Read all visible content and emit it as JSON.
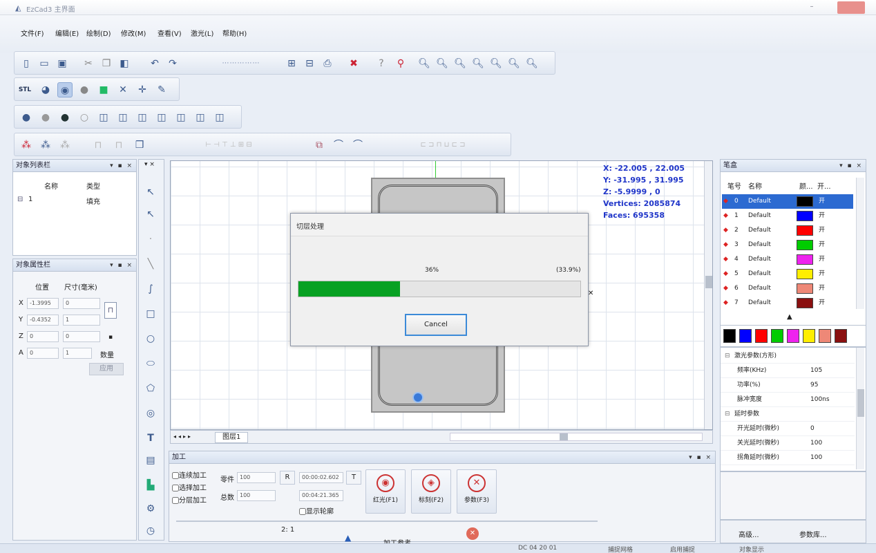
{
  "window": {
    "title": "EzCad3 主界面",
    "min_glyph": "–"
  },
  "menu": [
    {
      "label": "文件(F)"
    },
    {
      "label": "编辑(E)"
    },
    {
      "label": "绘制(D)"
    },
    {
      "label": "修改(M)"
    },
    {
      "label": "查看(V)"
    },
    {
      "label": "激光(L)"
    },
    {
      "label": "帮助(H)"
    }
  ],
  "toolbars": {
    "row1_icons": [
      "new-icon",
      "open-icon",
      "save-icon",
      "cut-icon",
      "copy-icon",
      "paste-icon",
      "undo-icon",
      "redo-icon",
      "grid-icon",
      "grid-icon",
      "grid-icon",
      "import-icon",
      "export-icon",
      "print-icon",
      "settings-icon",
      "laser-icon",
      "zoom-in-icon",
      "zoom-out-icon",
      "zoom-fit-icon",
      "zoom-select-icon",
      "zoom-all-icon",
      "zoom-prev-icon",
      "zoom-real-icon"
    ],
    "stl_label": "STL"
  },
  "left_panel": {
    "object_list": {
      "title": "对象列表栏",
      "ctrl": "▾ ▪ ×",
      "col_name": "名称",
      "col_type": "类型",
      "row_name": "1",
      "row_type": "填充"
    },
    "object_props": {
      "title": "对象属性栏",
      "ctrl": "▾ ▪ ×",
      "pos_label": "位置",
      "size_label": "尺寸(毫米)",
      "rows": [
        {
          "axis": "X",
          "pos": "-1.3995",
          "size": "0"
        },
        {
          "axis": "Y",
          "pos": "-0.4352",
          "size": "1"
        },
        {
          "axis": "Z",
          "pos": "0",
          "size": "0"
        },
        {
          "axis": "A",
          "pos": "0",
          "size": "1"
        }
      ],
      "apply_label": "应用",
      "exclude_label": "数量"
    }
  },
  "canvas": {
    "readout": {
      "x": "X: -22.005 , 22.005",
      "y": "Y: -31.995 , 31.995",
      "z": "Z: -5.9999 , 0",
      "vertices": "Vertices: 2085874",
      "faces": "Faces: 695358"
    },
    "tab_label": "图层1"
  },
  "dialog": {
    "title": "切层处理",
    "percent_text": "36%",
    "progress": 0.36,
    "remaining_text": "(33.9%)",
    "cancel_label": "Cancel"
  },
  "layers_panel": {
    "title": "笔盒",
    "ctrl": "▾ ▪ ×",
    "col_no": "笔号",
    "col_name": "名称",
    "col_color": "颜...",
    "col_on": "开...",
    "rows": [
      {
        "no": "0",
        "name": "Default",
        "color": "#000000",
        "on": "开"
      },
      {
        "no": "1",
        "name": "Default",
        "color": "#0000ff",
        "on": "开"
      },
      {
        "no": "2",
        "name": "Default",
        "color": "#ff0000",
        "on": "开"
      },
      {
        "no": "3",
        "name": "Default",
        "color": "#00cc00",
        "on": "开"
      },
      {
        "no": "4",
        "name": "Default",
        "color": "#ee22ee",
        "on": "开"
      },
      {
        "no": "5",
        "name": "Default",
        "color": "#ffee00",
        "on": "开"
      },
      {
        "no": "6",
        "name": "Default",
        "color": "#ee8877",
        "on": "开"
      },
      {
        "no": "7",
        "name": "Default",
        "color": "#8a1010",
        "on": "开"
      }
    ],
    "palette": [
      "#000000",
      "#0000ff",
      "#ff0000",
      "#00cc00",
      "#ee22ee",
      "#ffee00",
      "#ee8877",
      "#8a1010"
    ],
    "params": [
      {
        "label": "激光参数(方形)",
        "value": "",
        "group": true
      },
      {
        "label": "频率(KHz)",
        "value": "105"
      },
      {
        "label": "功率(%)",
        "value": "95"
      },
      {
        "label": "脉冲宽度",
        "value": "100ns"
      },
      {
        "label": "延时参数",
        "value": "",
        "group": true
      },
      {
        "label": "开光延时(微秒)",
        "value": "0"
      },
      {
        "label": "关光延时(微秒)",
        "value": "100"
      },
      {
        "label": "拐角延时(微秒)",
        "value": "100"
      }
    ],
    "btn_default": "高级...",
    "btn_params": "参数库..."
  },
  "processing": {
    "title": "加工",
    "ctrl": "▾ ▪ ×",
    "checks": [
      "连续加工",
      "选择加工",
      "分层加工"
    ],
    "count_label": "零件",
    "count_value": "100",
    "total_label": "总数",
    "total_value": "100",
    "r_label": "R",
    "time1": "00:00:02.602",
    "t_label": "T",
    "time2": "00:04:21.365",
    "continuous_label": "显示轮廓",
    "btn_red": "红光(F1)",
    "btn_mark": "标刻(F2)",
    "btn_param": "参数(F3)",
    "slider_text": "2:    1",
    "bottom_label": "加工参考"
  },
  "statusbar": {
    "s1": "DC  04  20  01",
    "s2": "捕捉网格",
    "s3": "启用捕捉",
    "s4": "对象显示"
  }
}
